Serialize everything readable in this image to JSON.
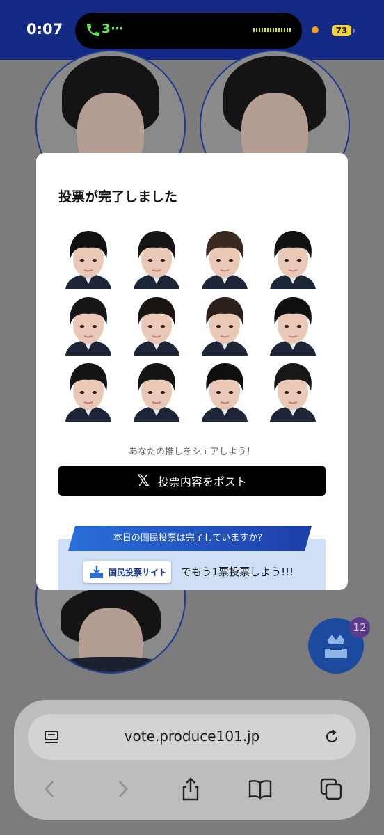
{
  "status_bar": {
    "time": "0:07",
    "call_indicator": "3⋯",
    "battery": "73"
  },
  "modal": {
    "title": "投票が完了しました",
    "share_hint": "あなたの推しをシェアしよう！",
    "post_button_label": "投票内容をポスト",
    "post_button_icon": "x-logo-icon",
    "banner": {
      "ribbon_text": "本日の国民投票は完了していますか？",
      "site_badge_label": "国民投票サイト",
      "cta_text": "でもう1票投票しよう!!!"
    }
  },
  "fab": {
    "badge_count": "12",
    "icon": "crown-ballot-icon"
  },
  "browser": {
    "url": "vote.produce101.jp"
  },
  "colors": {
    "status_bar": "#132a85",
    "accent": "#1b4a9e",
    "banner_ribbon": "#2a6fd9",
    "banner_bg": "#cfe0f6"
  }
}
